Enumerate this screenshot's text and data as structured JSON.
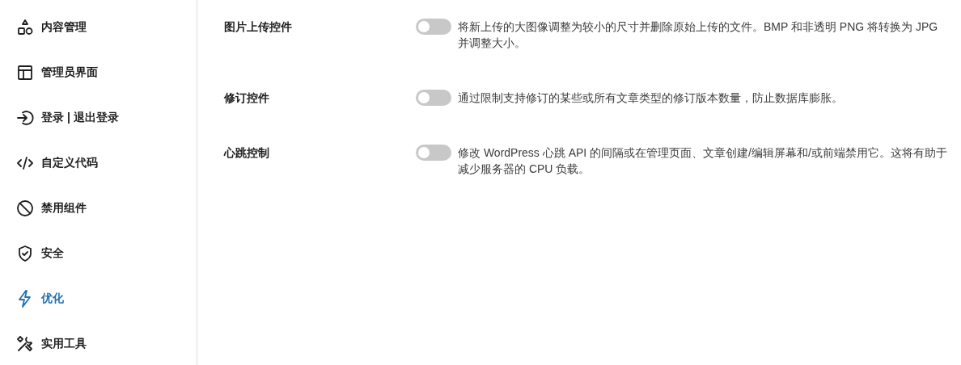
{
  "sidebar": {
    "items": [
      {
        "label": "内容管理",
        "selected": false
      },
      {
        "label": "管理员界面",
        "selected": false
      },
      {
        "label": "登录 | 退出登录",
        "selected": false
      },
      {
        "label": "自定义代码",
        "selected": false
      },
      {
        "label": "禁用组件",
        "selected": false
      },
      {
        "label": "安全",
        "selected": false
      },
      {
        "label": "优化",
        "selected": true
      },
      {
        "label": "实用工具",
        "selected": false
      }
    ]
  },
  "settings": [
    {
      "label": "图片上传控件",
      "on": false,
      "description": "将新上传的大图像调整为较小的尺寸并删除原始上传的文件。BMP 和非透明 PNG 将转换为 JPG 并调整大小。"
    },
    {
      "label": "修订控件",
      "on": false,
      "description": "通过限制支持修订的某些或所有文章类型的修订版本数量，防止数据库膨胀。"
    },
    {
      "label": "心跳控制",
      "on": false,
      "description": "修改 WordPress 心跳 API 的间隔或在管理页面、文章创建/编辑屏幕和/或前端禁用它。这将有助于减少服务器的 CPU 负载。"
    }
  ]
}
